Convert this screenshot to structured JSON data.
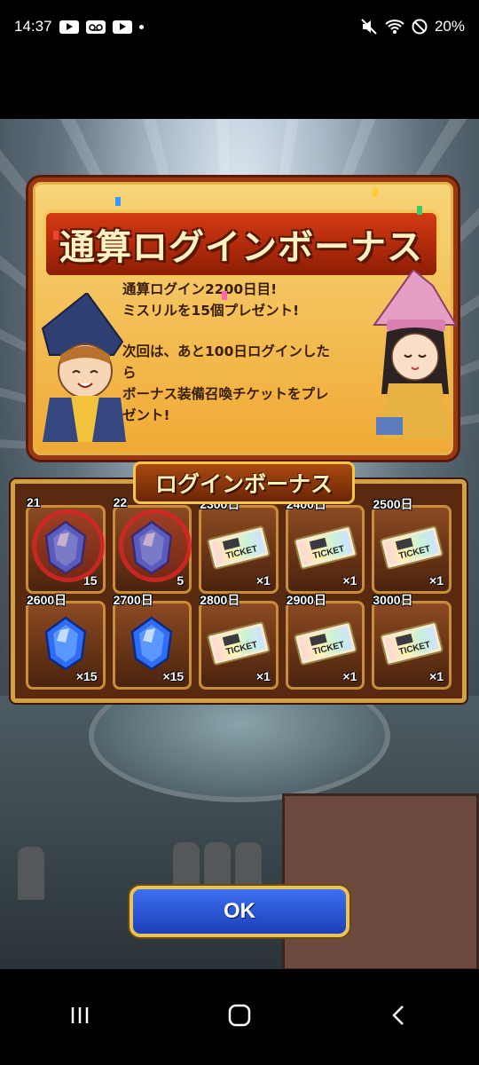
{
  "status_bar": {
    "time": "14:37",
    "battery": "20%",
    "left_icons": [
      "youtube-icon",
      "voicemail-icon",
      "youtube-icon",
      "dot-icon"
    ],
    "right_icons": [
      "mute-icon",
      "wifi-icon",
      "do-not-disturb-icon"
    ]
  },
  "header": {
    "title": "通算ログインボーナス",
    "message_line1": "通算ログイン2200日目!",
    "message_line2": "ミスリルを15個プレゼント!",
    "message_line3": "次回は、あと100日ログインした",
    "message_line4": "ら",
    "message_line5": "ボーナス装備召喚チケットをプレ",
    "message_line6": "ゼント!"
  },
  "bonus": {
    "label": "ログインボーナス",
    "items": [
      {
        "day": "21",
        "qty": "15",
        "type": "mithril",
        "claimed": true
      },
      {
        "day": "22",
        "qty": "5",
        "type": "mithril",
        "claimed": true
      },
      {
        "day": "2300日",
        "qty": "×1",
        "type": "ticket",
        "claimed": false
      },
      {
        "day": "2400日",
        "qty": "×1",
        "type": "ticket",
        "claimed": false
      },
      {
        "day": "2500日",
        "qty": "×1",
        "type": "ticket",
        "claimed": false
      },
      {
        "day": "2600日",
        "qty": "×15",
        "type": "mithril",
        "claimed": false
      },
      {
        "day": "2700日",
        "qty": "×15",
        "type": "mithril",
        "claimed": false
      },
      {
        "day": "2800日",
        "qty": "×1",
        "type": "ticket",
        "claimed": false
      },
      {
        "day": "2900日",
        "qty": "×1",
        "type": "ticket",
        "claimed": false
      },
      {
        "day": "3000日",
        "qty": "×1",
        "type": "ticket",
        "claimed": false
      }
    ],
    "ticket_text": "TICKET"
  },
  "ok_button": {
    "label": "OK"
  },
  "colors": {
    "accent": "#f0a934",
    "button": "#2b56d8",
    "frame": "#d2a043"
  }
}
